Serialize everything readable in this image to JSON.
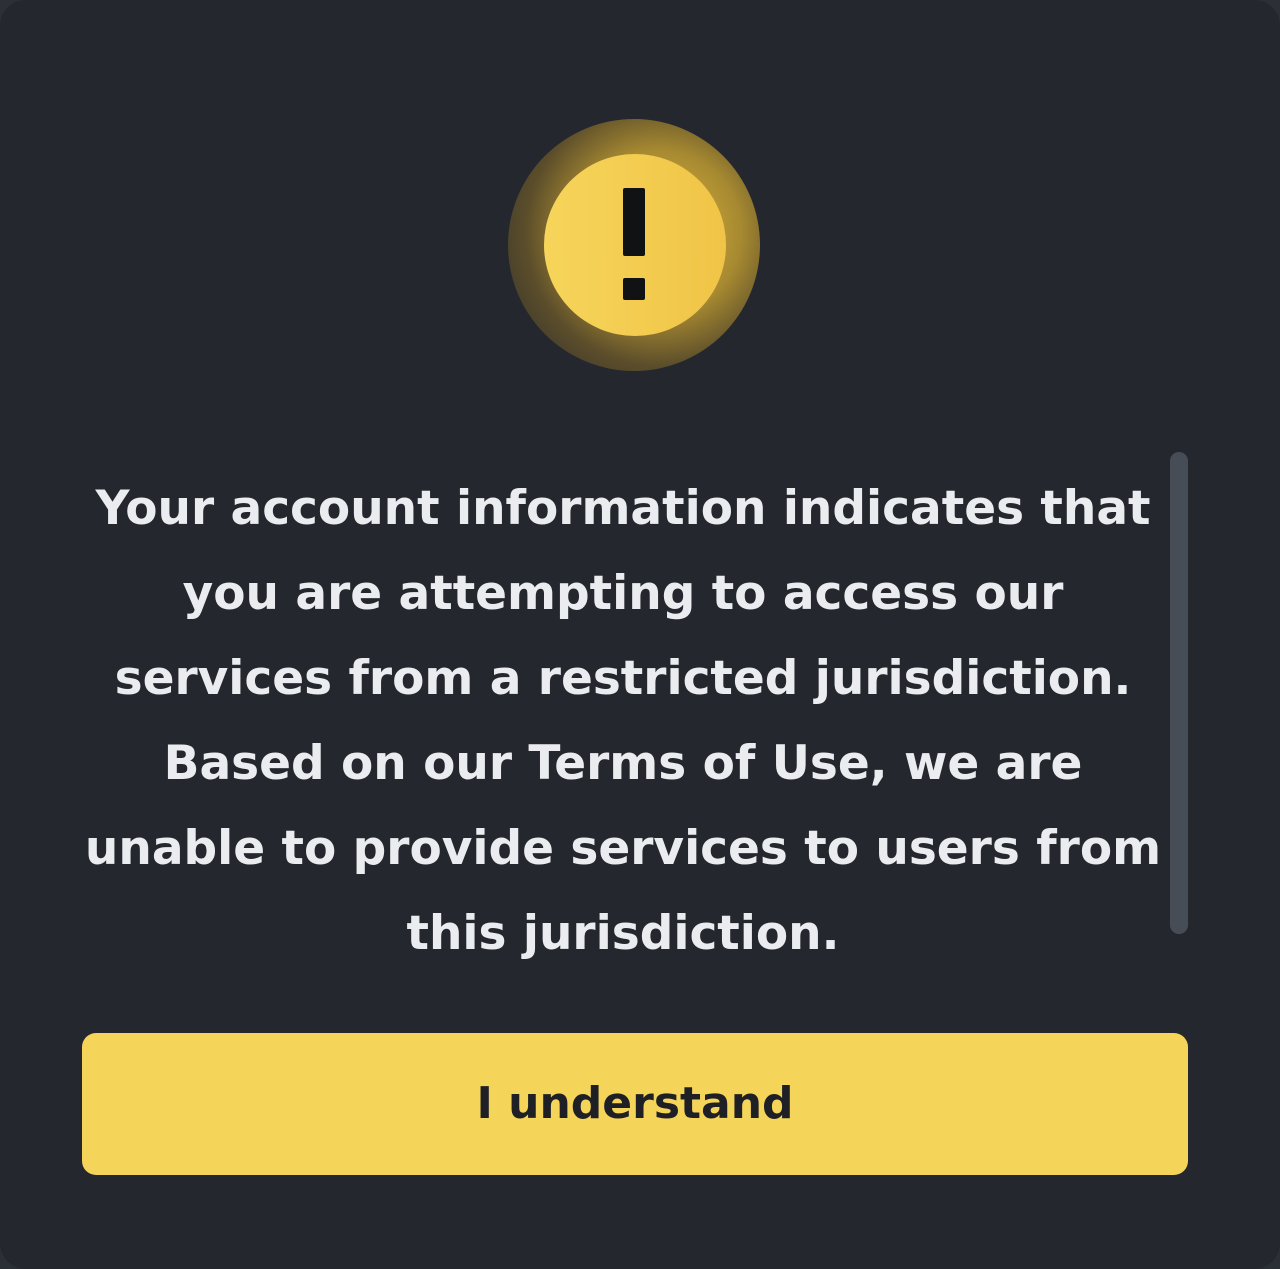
{
  "dialog": {
    "icon": "exclamation-warning-icon",
    "message": "Your account information indicates that you are attempting to access our services from a restricted jurisdiction. Based on our Terms of Use, we are unable to provide services to users from this jurisdiction.",
    "confirm_label": "I understand"
  },
  "colors": {
    "background": "#24272d",
    "accent": "#f5d45a",
    "text": "#eaecef",
    "button_text": "#1e2026",
    "scrollbar": "#474d57"
  }
}
